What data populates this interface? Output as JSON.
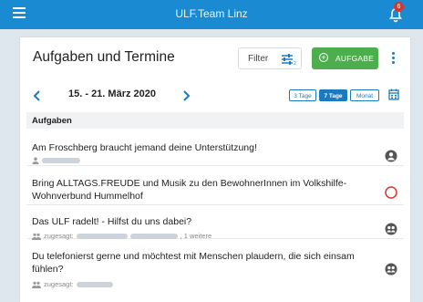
{
  "header": {
    "title": "ULF.Team Linz",
    "badge": "6"
  },
  "page": {
    "title": "Aufgaben und Termine"
  },
  "toolbar": {
    "filter_label": "Filter",
    "add_label": "AUFGABE"
  },
  "nav": {
    "date_range": "15. - 21. März 2020",
    "views": [
      "3 Tage",
      "7 Tage",
      "Monat"
    ],
    "active_view": "7 Tage"
  },
  "section": {
    "title": "Aufgaben"
  },
  "tasks": [
    {
      "title": "Am Froschberg braucht jemand deine Unterstützung!",
      "meta_prefix": "",
      "meta_suffix": "",
      "status": "user-icon"
    },
    {
      "title": "Bring ALLTAGS.FREUDE und Musik zu den BewohnerInnen im Volkshilfe-Wohnverbund Hummelhof",
      "meta_prefix": "",
      "meta_suffix": "",
      "status": "open-circle-icon"
    },
    {
      "title": "Das ULF radelt! - Hilfst du uns dabei?",
      "meta_prefix": "zugesagt:",
      "meta_suffix": ", 1 weitere",
      "status": "group-icon"
    },
    {
      "title": "Du telefonierst gerne und möchtest mit Menschen plaudern, die sich einsam fühlen?",
      "meta_prefix": "zugesagt:",
      "meta_suffix": "",
      "status": "group-icon"
    }
  ],
  "colors": {
    "primary": "#1a8ad2",
    "accent_green": "#4cae4c",
    "alert_red": "#e0312b"
  }
}
